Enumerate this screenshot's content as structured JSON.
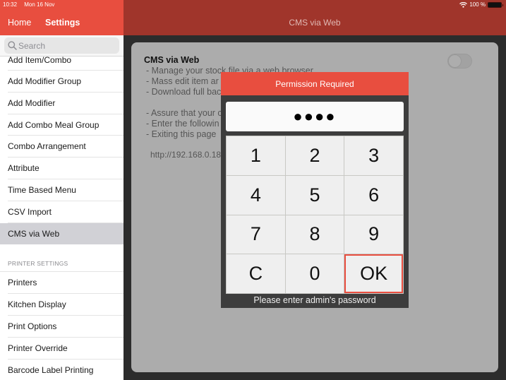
{
  "status_bar": {
    "time": "10:32",
    "date": "Mon 16 Nov",
    "battery": "100 %",
    "wifi_icon": "wifi-icon",
    "battery_icon": "battery-icon"
  },
  "sidebar": {
    "nav_back": "Home",
    "title": "Settings",
    "search": {
      "placeholder": "Search",
      "value": "",
      "icon": "search-icon"
    },
    "items": [
      {
        "label": "Add Item/Combo"
      },
      {
        "label": "Add Modifier Group"
      },
      {
        "label": "Add Modifier"
      },
      {
        "label": "Add Combo Meal Group"
      },
      {
        "label": "Combo Arrangement"
      },
      {
        "label": "Attribute"
      },
      {
        "label": "Time Based Menu"
      },
      {
        "label": "CSV Import"
      },
      {
        "label": "CMS via Web",
        "selected": true
      }
    ],
    "printer_section": {
      "header": "PRINTER SETTINGS",
      "items": [
        {
          "label": "Printers"
        },
        {
          "label": "Kitchen Display"
        },
        {
          "label": "Print Options"
        },
        {
          "label": "Printer Override"
        },
        {
          "label": "Barcode Label Printing"
        }
      ]
    }
  },
  "main": {
    "title": "CMS via Web",
    "card": {
      "title": "CMS via Web",
      "lines": [
        "- Manage your stock file via a web browser",
        "- Mass edit item ar",
        "- Download full bac",
        "",
        "- Assure that your c",
        "- Enter the followin",
        "- Exiting this page"
      ],
      "url": "http://192.168.0.18",
      "toggle_on": false
    }
  },
  "dialog": {
    "title": "Permission Required",
    "pin_display": "●●●●",
    "keys": [
      "1",
      "2",
      "3",
      "4",
      "5",
      "6",
      "7",
      "8",
      "9",
      "C",
      "0",
      "OK"
    ],
    "footer": "Please enter admin's password"
  },
  "colors": {
    "accent": "#e84e3f",
    "header_dark": "#a0352b",
    "selected_row": "#d1d1d6"
  }
}
